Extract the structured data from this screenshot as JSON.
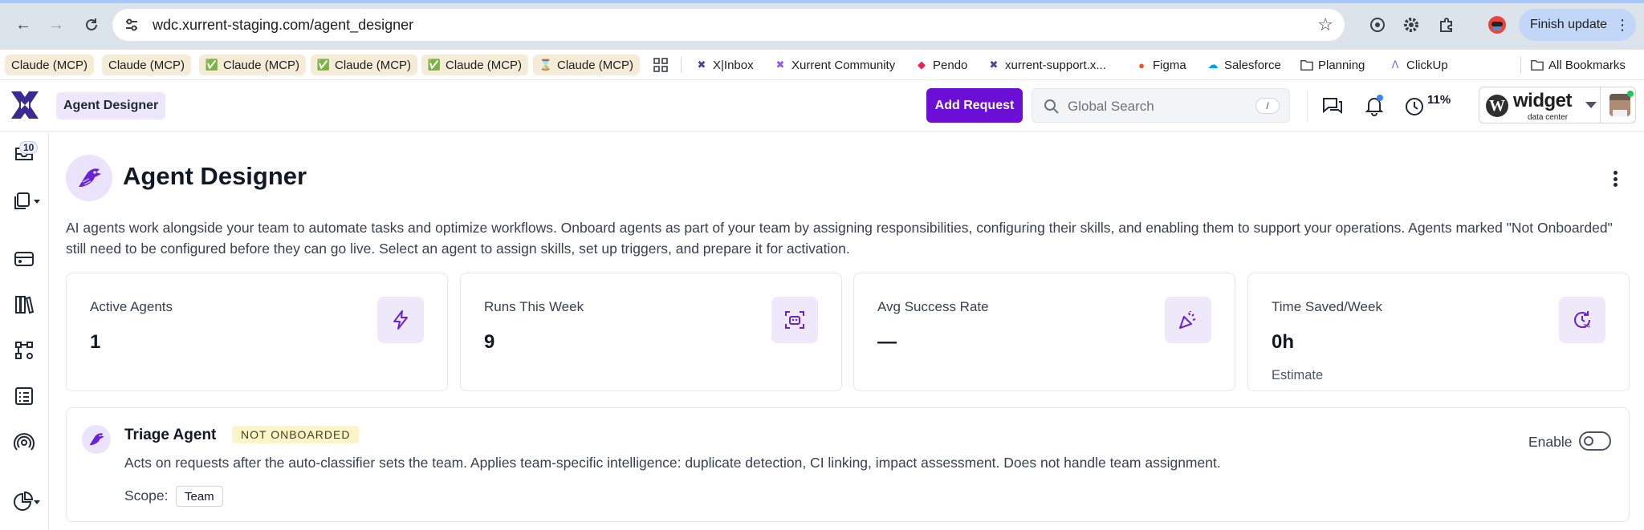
{
  "browser": {
    "url": "wdc.xurrent-staging.com/agent_designer",
    "finish_update": "Finish update",
    "bookmarks": [
      {
        "label": "Claude (MCP)",
        "prefix": ""
      },
      {
        "label": "Claude (MCP)",
        "prefix": ""
      },
      {
        "label": "Claude (MCP)",
        "prefix": "✅"
      },
      {
        "label": "Claude (MCP)",
        "prefix": "✅"
      },
      {
        "label": "Claude (MCP)",
        "prefix": "✅"
      },
      {
        "label": "Claude (MCP)",
        "prefix": "⌛"
      }
    ],
    "links": [
      {
        "label": "X|Inbox"
      },
      {
        "label": "Xurrent Community"
      },
      {
        "label": "Pendo"
      },
      {
        "label": "xurrent-support.x..."
      },
      {
        "label": "Figma"
      },
      {
        "label": "Salesforce"
      },
      {
        "label": "Planning"
      },
      {
        "label": "ClickUp"
      }
    ],
    "all_bookmarks": "All Bookmarks"
  },
  "header": {
    "breadcrumb": "Agent Designer",
    "add_request": "Add Request",
    "search_placeholder": "Global Search",
    "search_shortcut": "/",
    "progress_percent": "11%",
    "account_brand": "widget",
    "account_sub": "data center"
  },
  "sidebar": {
    "inbox_badge": "10",
    "items": [
      "inbox",
      "documents",
      "service-desk",
      "library",
      "workflows",
      "lists",
      "broadcast",
      "analytics"
    ]
  },
  "page": {
    "title": "Agent Designer",
    "intro": "AI agents work alongside your team to automate tasks and optimize workflows. Onboard agents as part of your team by assigning responsibilities, configuring their skills, and enabling them to support your operations. Agents marked \"Not Onboarded\" still need to be configured before they can go live. Select an agent to assign skills, set up triggers, and prepare it for activation."
  },
  "stats": [
    {
      "label": "Active Agents",
      "value": "1",
      "note": "",
      "icon": "lightning-icon"
    },
    {
      "label": "Runs This Week",
      "value": "9",
      "note": "",
      "icon": "bot-scan-icon"
    },
    {
      "label": "Avg Success Rate",
      "value": "—",
      "note": "",
      "icon": "party-popper-icon"
    },
    {
      "label": "Time Saved/Week",
      "value": "0h",
      "note": "Estimate",
      "icon": "clock-24-icon"
    }
  ],
  "agent": {
    "name": "Triage Agent",
    "status": "NOT ONBOARDED",
    "description": "Acts on requests after the auto-classifier sets the team. Applies team-specific intelligence: duplicate detection, CI linking, impact assessment. Does not handle team assignment.",
    "scope_label": "Scope:",
    "scope_value": "Team",
    "enable_label": "Enable",
    "enabled": false
  },
  "colors": {
    "accent": "#6b0fd6",
    "icon_bg": "#ede9fb",
    "status_bg": "#fdf4c7"
  }
}
